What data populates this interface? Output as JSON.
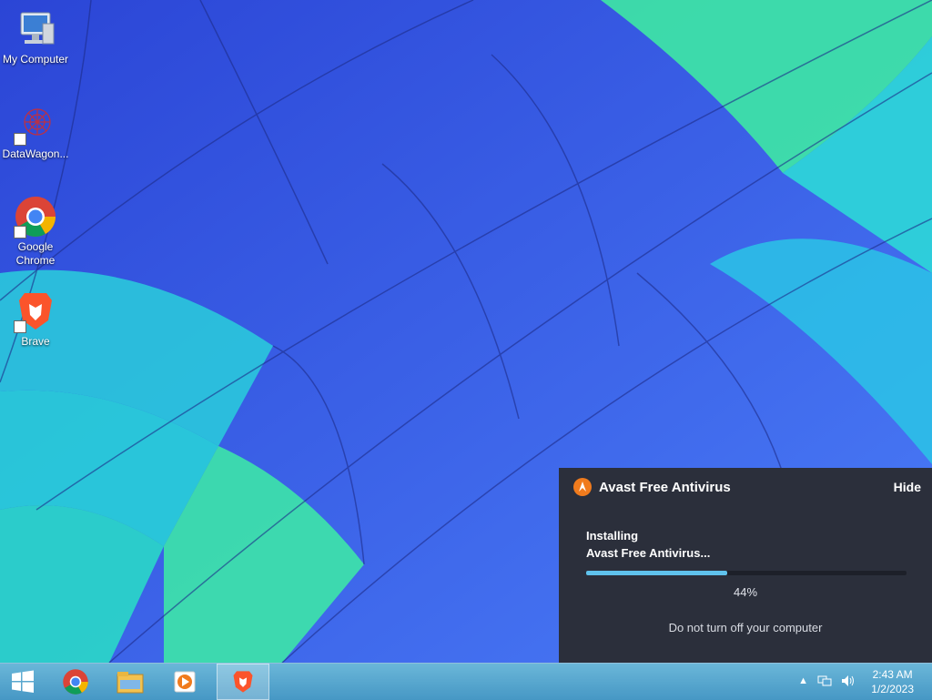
{
  "desktop": {
    "icons": [
      {
        "label": "My Computer",
        "icon": "computer-icon"
      },
      {
        "label": "DataWagon...",
        "icon": "datawagon-icon"
      },
      {
        "label": "Google Chrome",
        "icon": "chrome-icon"
      },
      {
        "label": "Brave",
        "icon": "brave-icon"
      }
    ]
  },
  "avast": {
    "title": "Avast Free Antivirus",
    "hide_label": "Hide",
    "status_line1": "Installing",
    "status_line2": "Avast Free Antivirus...",
    "progress": 0.44,
    "percent_text": "44%",
    "warning": "Do not turn off your computer",
    "accent_color": "#5fc2ec",
    "logo_color": "#f07b1d"
  },
  "taskbar": {
    "items": [
      "start-button",
      "chrome",
      "file-explorer",
      "media-player",
      "brave"
    ],
    "time": "2:43 AM",
    "date": "1/2/2023"
  }
}
